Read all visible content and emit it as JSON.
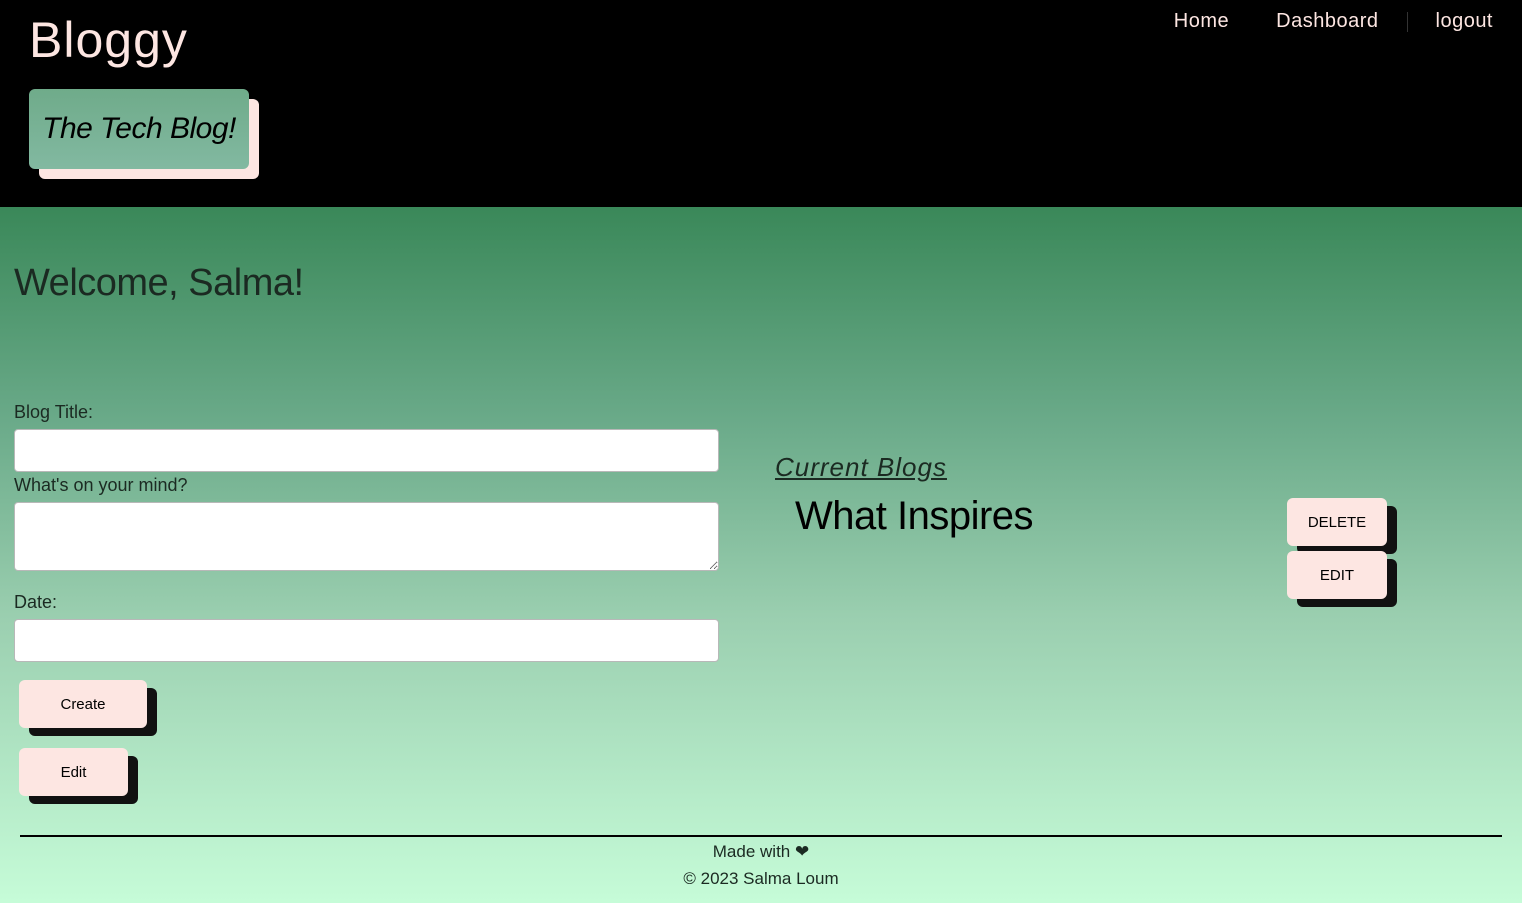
{
  "header": {
    "brand": "Bloggy",
    "tagline": "The Tech Blog!",
    "nav": {
      "home": "Home",
      "dashboard": "Dashboard",
      "logout": "logout"
    }
  },
  "main": {
    "welcome": "Welcome, Salma!",
    "form": {
      "title_label": "Blog Title:",
      "title_value": "",
      "body_label": "What's on your mind?",
      "body_value": "",
      "date_label": "Date:",
      "date_value": "",
      "create_label": "Create",
      "edit_label": "Edit"
    },
    "current_blogs": {
      "heading": "Current Blogs",
      "items": [
        {
          "title": "What Inspires",
          "delete_label": "DELETE",
          "edit_label": "EDIT"
        }
      ]
    }
  },
  "footer": {
    "made_with": "Made with",
    "heart_icon": "heart-icon",
    "heart_glyph": "❤",
    "copyright": "© 2023 Salma Loum"
  },
  "colors": {
    "header_bg": "#000000",
    "brand_text": "#fde6e2",
    "button_bg": "#fde6e2",
    "button_shadow": "#111111",
    "tagline_bg": "#75b094",
    "gradient_top": "#3a8859",
    "gradient_bottom": "#c6fcd8"
  }
}
